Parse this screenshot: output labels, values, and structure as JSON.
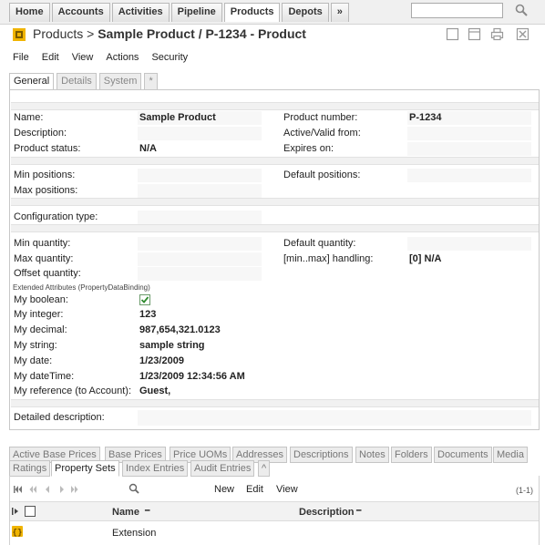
{
  "nav": {
    "tabs": [
      "Home",
      "Accounts",
      "Activities",
      "Pipeline",
      "Products",
      "Depots",
      "»"
    ],
    "search": {
      "value": "",
      "placeholder": ""
    }
  },
  "header": {
    "module": "Products",
    "separator": ">",
    "record_title": "Sample Product / P-1234 - Product"
  },
  "menu": [
    "File",
    "Edit",
    "View",
    "Actions",
    "Security"
  ],
  "subtabs": [
    "General",
    "Details",
    "System",
    "*"
  ],
  "form": {
    "name_label": "Name:",
    "name_value": "Sample Product",
    "product_number_label": "Product number:",
    "product_number_value": "P-1234",
    "description_label": "Description:",
    "active_valid_from_label": "Active/Valid from:",
    "product_status_label": "Product status:",
    "product_status_value": "N/A",
    "expires_on_label": "Expires on:",
    "min_positions_label": "Min positions:",
    "default_positions_label": "Default positions:",
    "max_positions_label": "Max positions:",
    "configuration_type_label": "Configuration type:",
    "min_quantity_label": "Min quantity:",
    "default_quantity_label": "Default quantity:",
    "max_quantity_label": "Max quantity:",
    "minmax_handling_label": "[min..max] handling:",
    "minmax_handling_value": "[0] N/A",
    "offset_quantity_label": "Offset quantity:",
    "extended_caption": "Extended Attributes (PropertyDataBinding)",
    "my_boolean_label": "My boolean:",
    "my_boolean_checked": true,
    "my_integer_label": "My integer:",
    "my_integer_value": "123",
    "my_decimal_label": "My decimal:",
    "my_decimal_value": "987,654,321.0123",
    "my_string_label": "My string:",
    "my_string_value": "sample string",
    "my_date_label": "My date:",
    "my_date_value": "1/23/2009",
    "my_datetime_label": "My dateTime:",
    "my_datetime_value": "1/23/2009 12:34:56 AM",
    "my_reference_label": "My reference (to Account):",
    "my_reference_value": "Guest,",
    "detailed_description_label": "Detailed description:"
  },
  "bottom_tabs": {
    "row1": [
      "Active Base Prices",
      "Base Prices",
      "Price UOMs",
      "Addresses",
      "Descriptions",
      "Notes",
      "Folders",
      "Documents",
      "Media"
    ],
    "row2": [
      "Ratings",
      "Property Sets",
      "Index Entries",
      "Audit Entries",
      "^"
    ]
  },
  "grid": {
    "actions": [
      "New",
      "Edit",
      "View"
    ],
    "count": "(1-1)",
    "columns": [
      "Name",
      "Description"
    ],
    "rows": [
      {
        "name": "Extension"
      }
    ]
  },
  "colors": {
    "accent": "#f0b400",
    "nav_bg": "#f0f0f0",
    "separator_bg": "#f1f1f1",
    "check_green": "#2e8b2e"
  },
  "icons": [
    "search-icon",
    "product-icon",
    "window-icons",
    "pager-icons",
    "magnifier-icon",
    "property-set-icon"
  ]
}
